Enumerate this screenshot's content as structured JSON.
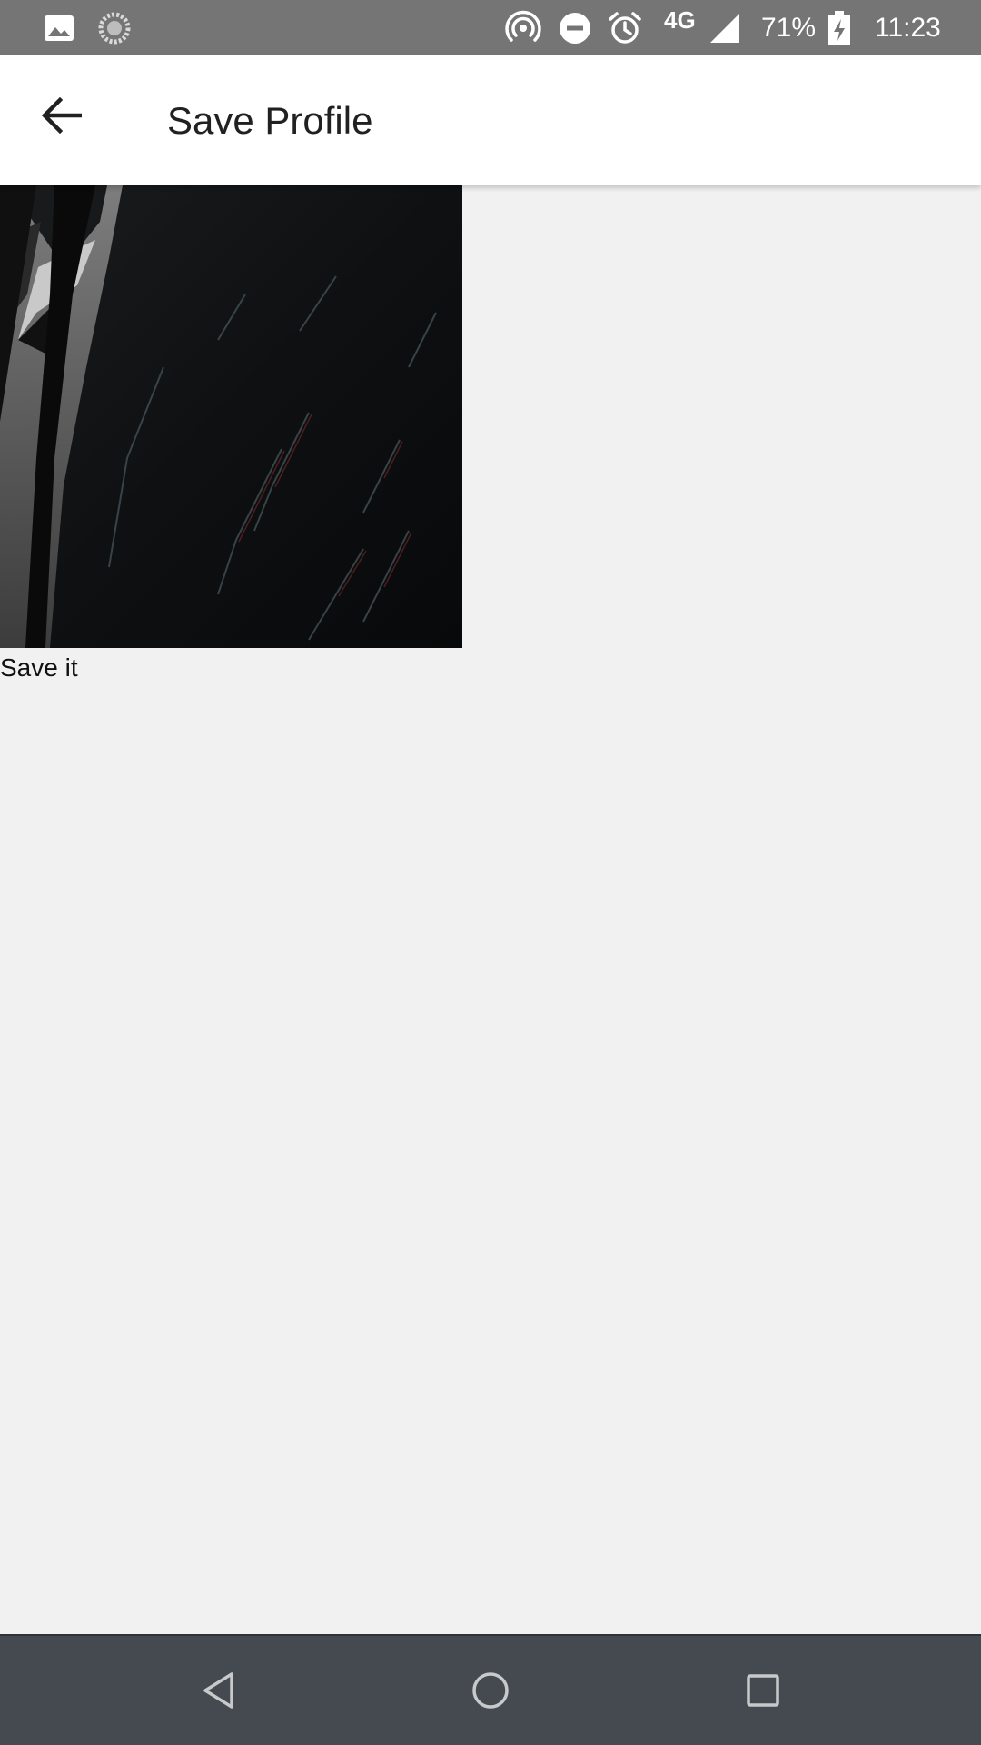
{
  "status_bar": {
    "battery_percent": "71%",
    "network_type": "4G",
    "time": "11:23",
    "icons": [
      "gallery-icon",
      "sync-icon",
      "hotspot-icon",
      "do-not-disturb-icon",
      "alarm-icon",
      "signal-icon",
      "battery-charging-icon"
    ]
  },
  "app_bar": {
    "title": "Save Profile",
    "back_icon": "arrow-back-icon"
  },
  "content": {
    "caption": "Save it"
  },
  "nav_bar": {
    "icons": [
      "nav-back-icon",
      "nav-home-icon",
      "nav-recents-icon"
    ]
  },
  "colors": {
    "status_bar": "#757575",
    "app_bar": "#ffffff",
    "background": "#f1f1f1",
    "nav_bar": "#444a50"
  }
}
